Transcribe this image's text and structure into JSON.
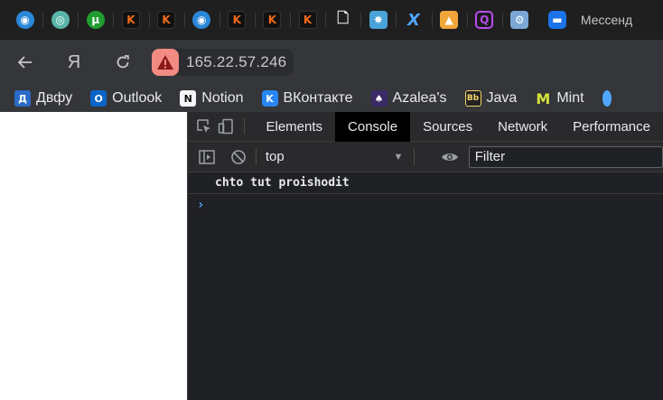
{
  "tabs": {
    "pinned_icons": [
      "gamepad-icon",
      "game-controller-icon",
      "utorrent-icon",
      "kinopoisk-icon",
      "kinopoisk-icon",
      "gamepad-icon",
      "kinopoisk-icon",
      "kinopoisk-icon",
      "kinopoisk-icon",
      "document-icon",
      "puzzle-icon",
      "x-icon",
      "figma-icon",
      "q-icon",
      "gear-icon",
      "messenger-icon"
    ],
    "active_title": "Мессенд"
  },
  "toolbar": {
    "back_icon": "back-arrow-icon",
    "yandex_label": "Я",
    "reload_icon": "reload-icon",
    "security_icon": "warning-icon",
    "url": "165.22.57.246"
  },
  "bookmarks": [
    {
      "label": "Двфу",
      "icon": "dvfu-icon"
    },
    {
      "label": "Outlook",
      "icon": "outlook-icon"
    },
    {
      "label": "Notion",
      "icon": "notion-icon"
    },
    {
      "label": "ВКонтакте",
      "icon": "vk-icon"
    },
    {
      "label": "Azalea's",
      "icon": "azalea-icon"
    },
    {
      "label": "Java",
      "icon": "bb-icon"
    },
    {
      "label": "Mint",
      "icon": "mint-icon"
    }
  ],
  "devtools": {
    "tabs": [
      "Elements",
      "Console",
      "Sources",
      "Network",
      "Performance"
    ],
    "active_tab": "Console",
    "context": "top",
    "filter_placeholder": "Filter",
    "console_messages": [
      "chto tut proishodit"
    ],
    "prompt_symbol": "›"
  },
  "colors": {
    "accent": "#4fa6ff",
    "warning": "#f28b82",
    "toolbar_bg": "#35363a",
    "devtools_bg": "#202124"
  }
}
